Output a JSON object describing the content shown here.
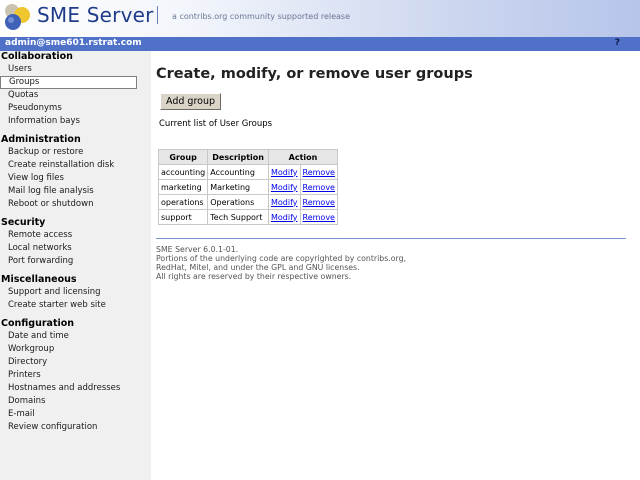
{
  "header": {
    "brand": "SME Server",
    "tagline": "a contribs.org community supported release"
  },
  "statusbar": {
    "user": "admin@sme601.rstrat.com",
    "help": "?"
  },
  "sidebar": {
    "sections": [
      {
        "heading": "Collaboration",
        "items": [
          "Users",
          "Groups",
          "Quotas",
          "Pseudonyms",
          "Information bays"
        ]
      },
      {
        "heading": "Administration",
        "items": [
          "Backup or restore",
          "Create reinstallation disk",
          "View log files",
          "Mail log file analysis",
          "Reboot or shutdown"
        ]
      },
      {
        "heading": "Security",
        "items": [
          "Remote access",
          "Local networks",
          "Port forwarding"
        ]
      },
      {
        "heading": "Miscellaneous",
        "items": [
          "Support and licensing",
          "Create starter web site"
        ]
      },
      {
        "heading": "Configuration",
        "items": [
          "Date and time",
          "Workgroup",
          "Directory",
          "Printers",
          "Hostnames and addresses",
          "Domains",
          "E-mail",
          "Review configuration"
        ]
      }
    ],
    "selected": "Groups"
  },
  "main": {
    "title": "Create, modify, or remove user groups",
    "add_button": "Add group",
    "list_heading": "Current list of User Groups",
    "table": {
      "columns": [
        "Group",
        "Description",
        "Action"
      ],
      "rows": [
        {
          "group": "accounting",
          "description": "Accounting",
          "modify": "Modify",
          "remove": "Remove"
        },
        {
          "group": "marketing",
          "description": "Marketing",
          "modify": "Modify",
          "remove": "Remove"
        },
        {
          "group": "operations",
          "description": "Operations",
          "modify": "Modify",
          "remove": "Remove"
        },
        {
          "group": "support",
          "description": "Tech Support",
          "modify": "Modify",
          "remove": "Remove"
        }
      ]
    },
    "footer": [
      "SME Server 6.0.1-01.",
      "Portions of the underlying code are copyrighted by contribs.org,",
      "RedHat, Mitel, and under the GPL and GNU licenses.",
      "All rights are reserved by their respective owners."
    ]
  },
  "colors": {
    "brand": "#1f3c88",
    "statusbar": "#4f72c8",
    "sidebar": "#f0f0f0",
    "link": "#0000ee"
  },
  "icons": {
    "logo": "sme-server-logo-icon"
  }
}
